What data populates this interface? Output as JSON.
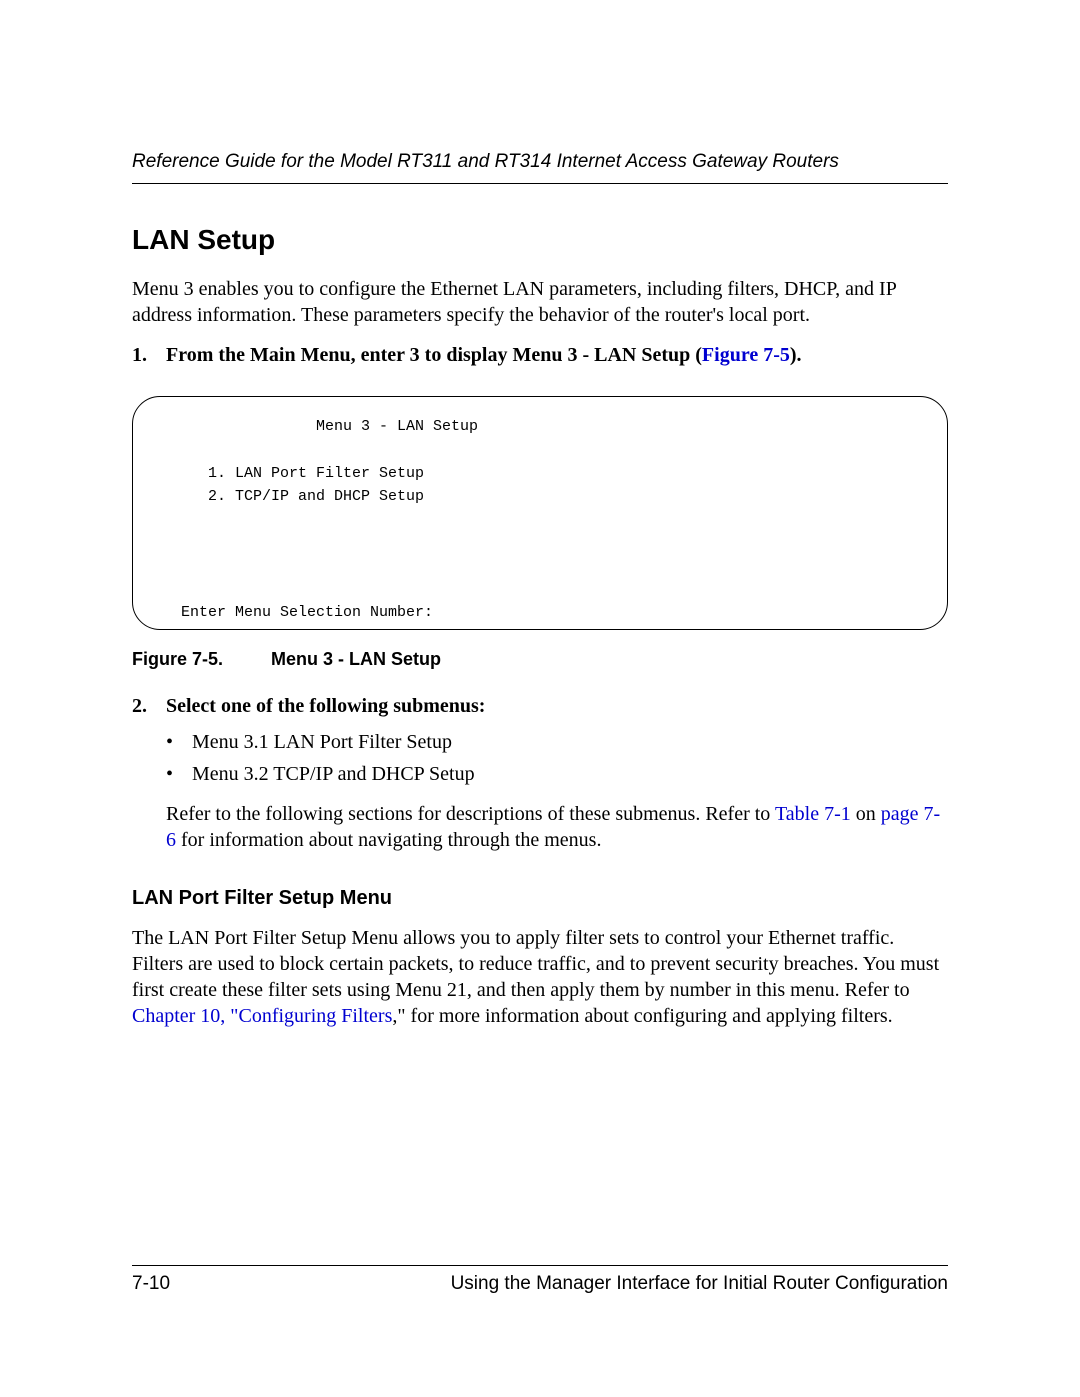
{
  "header": {
    "running_title": "Reference Guide for the Model RT311 and RT314 Internet Access Gateway Routers"
  },
  "section": {
    "title": "LAN Setup",
    "intro": "Menu 3 enables you to configure the Ethernet LAN parameters, including filters, DHCP, and IP address information. These parameters specify the behavior of the router's local port."
  },
  "steps": {
    "s1": {
      "num": "1.",
      "text_pre": "From the Main Menu, enter 3 to display Menu 3 - LAN Setup (",
      "fig_link": "Figure 7-5",
      "text_post": ")."
    },
    "s2": {
      "num": "2.",
      "text": "Select one of the following submenus:",
      "bullets": {
        "b1": "Menu 3.1 LAN Port Filter Setup",
        "b2": "Menu 3.2 TCP/IP and DHCP Setup"
      },
      "refer_pre": "Refer to the following sections for descriptions of these submenus. Refer to ",
      "table_link": "Table 7-1",
      "refer_mid": " on ",
      "page_link": "page 7-6",
      "refer_post": " for information about navigating through the menus."
    }
  },
  "terminal": {
    "title": "                 Menu 3 - LAN Setup",
    "item1": "     1. LAN Port Filter Setup",
    "item2": "     2. TCP/IP and DHCP Setup",
    "prompt": "  Enter Menu Selection Number:"
  },
  "figure": {
    "label": "Figure 7-5.",
    "caption": "Menu 3 - LAN Setup"
  },
  "subsection": {
    "title": "LAN Port Filter Setup Menu",
    "p_pre": "The LAN Port Filter Setup Menu allows you to apply filter sets to control your Ethernet traffic. Filters are used to block certain packets, to reduce traffic, and to prevent security breaches. You must first create these filter sets using Menu 21, and then apply them by number in this menu. Refer to ",
    "chapter_link": "Chapter 10, \"Configuring Filters",
    "p_post": ",\" for more information about configuring and applying filters."
  },
  "footer": {
    "page_num": "7-10",
    "chapter_title": "Using the Manager Interface for Initial Router Configuration"
  }
}
